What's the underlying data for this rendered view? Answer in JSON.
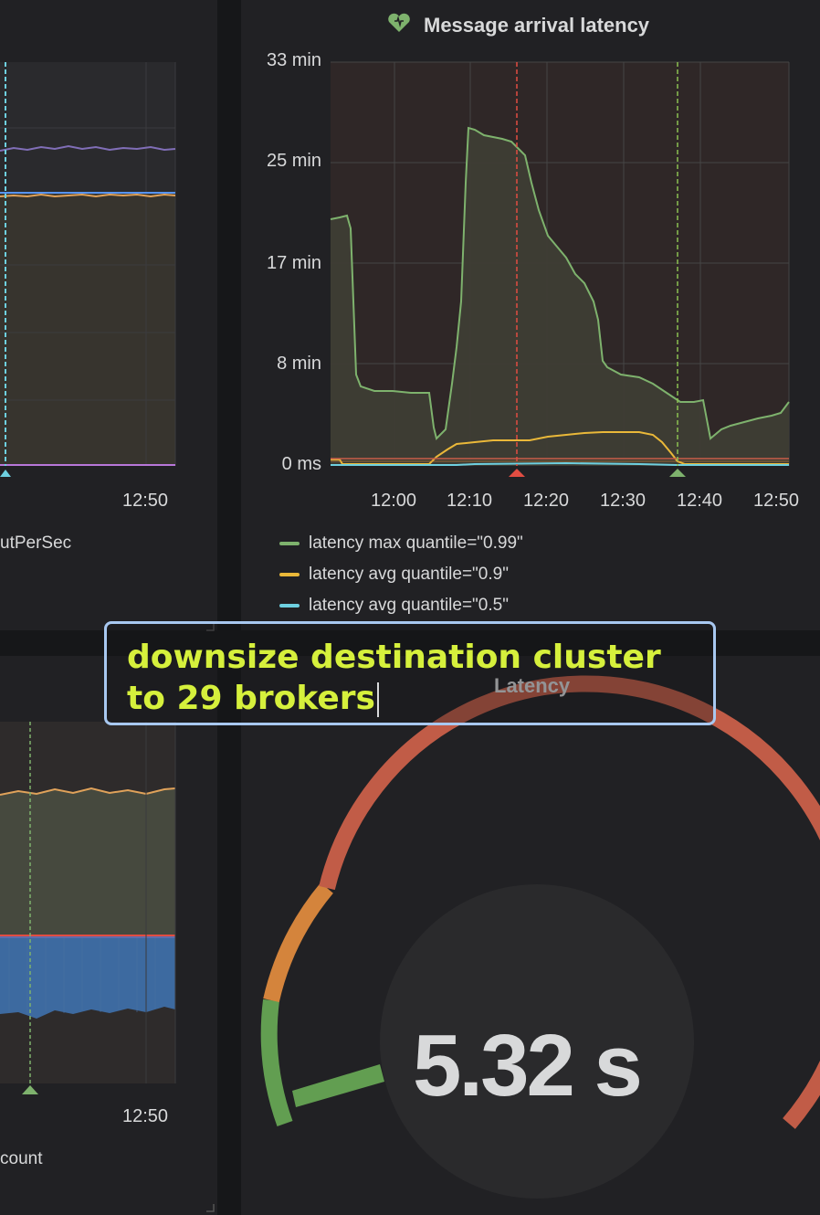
{
  "left_top_panel": {
    "x_tick": "12:50",
    "legend_partial": "utPerSec"
  },
  "left_bottom_panel": {
    "x_tick": "12:50",
    "legend_partial": "count"
  },
  "latency_graph": {
    "title": "Message arrival latency",
    "title_icon": "heart-icon",
    "y_ticks": [
      "33 min",
      "25 min",
      "17 min",
      "8 min",
      "0 ms"
    ],
    "x_ticks": [
      "12:00",
      "12:10",
      "12:20",
      "12:30",
      "12:40",
      "12:50"
    ],
    "legend": [
      {
        "label": "latency max quantile=\"0.99\"",
        "color": "#7eb26d"
      },
      {
        "label": "latency avg quantile=\"0.9\"",
        "color": "#eab839"
      },
      {
        "label": "latency avg quantile=\"0.5\"",
        "color": "#6ed0e0"
      }
    ],
    "annotation_colors": {
      "red": "#e24d42",
      "green": "#7eb26d"
    }
  },
  "annotation_editor": {
    "text_line1": "downsize destination cluster",
    "text_line2": "to 29 brokers",
    "text_color": "#d6f03c",
    "border_color": "#a8c8f0"
  },
  "gauge_panel": {
    "title": "Latency",
    "value": "5.32 s",
    "value_fraction": 0.12,
    "threshold_colors": [
      "#629e51",
      "#d4843c",
      "#c15c47"
    ]
  }
}
